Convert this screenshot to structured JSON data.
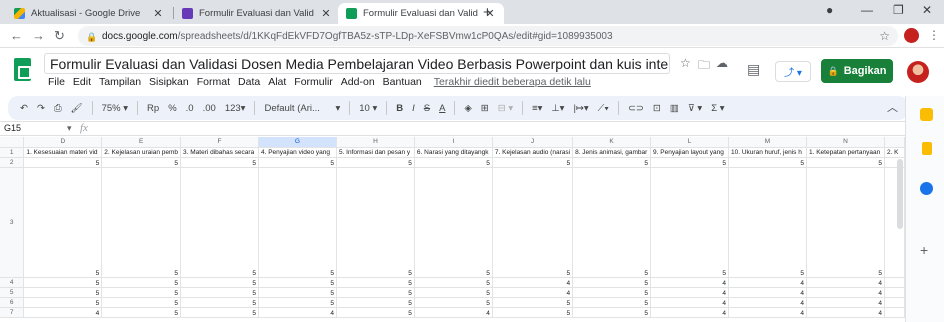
{
  "browser": {
    "tabs": [
      {
        "title": "Aktualisasi - Google Drive",
        "active": false
      },
      {
        "title": "Formulir Evaluasi dan Validasi Do",
        "active": false
      },
      {
        "title": "Formulir Evaluasi dan Validasi Do",
        "active": true
      }
    ],
    "url_host": "docs.google.com",
    "url_path": "/spreadsheets/d/1KKqFdEkVFD7OgfTBA5z-sTP-LDp-XeFSBVmw1cP0QAs/edit#gid=1089935003"
  },
  "doc": {
    "title": "Formulir Evaluasi dan Validasi Dosen Media Pembelajaran Video Berbasis Powerpoint dan kuis interaktif men...",
    "menus": [
      "File",
      "Edit",
      "Tampilan",
      "Sisipkan",
      "Format",
      "Data",
      "Alat",
      "Formulir",
      "Add-on",
      "Bantuan"
    ],
    "last_edit": "Terakhir diedit beberapa detik lalu",
    "share_label": "Bagikan"
  },
  "toolbar": {
    "zoom": "75%",
    "currency": "Rp",
    "percent": "%",
    "dec_less": ".0",
    "dec_more": ".00",
    "number_format": "123",
    "font": "Default (Ari...",
    "font_size": "10"
  },
  "formula_bar": {
    "cell_ref": "G15",
    "fx": "fx"
  },
  "sheet": {
    "columns": [
      "D",
      "E",
      "F",
      "G",
      "H",
      "I",
      "J",
      "K",
      "L",
      "M",
      "N"
    ],
    "selected_column": "G",
    "headers": [
      "1. Kesesuaian materi vid",
      "2. Kejelasan uraian pemb",
      "3. Materi dibahas secara",
      "4. Penyajian video yang",
      "5. Informasi dan pesan y",
      "6. Narasi yang ditayangk",
      "7. Kejelasan audio (narasi",
      "8. Jenis animasi, gambar",
      "9. Penyajian layout yang",
      "10. Ukuran huruf, jenis h",
      "1. Ketepatan pertanyaan",
      "2. K"
    ],
    "rows": [
      {
        "num": "2",
        "values": [
          "5",
          "5",
          "5",
          "5",
          "5",
          "5",
          "5",
          "5",
          "5",
          "5",
          "5"
        ]
      },
      {
        "num": "3",
        "values": [
          "5",
          "5",
          "5",
          "5",
          "5",
          "5",
          "5",
          "5",
          "5",
          "5",
          "5"
        ]
      },
      {
        "num": "4",
        "values": [
          "5",
          "5",
          "5",
          "5",
          "5",
          "5",
          "4",
          "5",
          "4",
          "4",
          "4"
        ]
      },
      {
        "num": "5",
        "values": [
          "5",
          "5",
          "5",
          "5",
          "5",
          "5",
          "4",
          "5",
          "4",
          "4",
          "4"
        ]
      },
      {
        "num": "6",
        "values": [
          "5",
          "5",
          "5",
          "5",
          "5",
          "5",
          "5",
          "5",
          "4",
          "4",
          "4"
        ]
      },
      {
        "num": "7",
        "values": [
          "4",
          "5",
          "5",
          "4",
          "5",
          "4",
          "5",
          "5",
          "4",
          "4",
          "4"
        ]
      }
    ],
    "header_row_num": "1"
  }
}
